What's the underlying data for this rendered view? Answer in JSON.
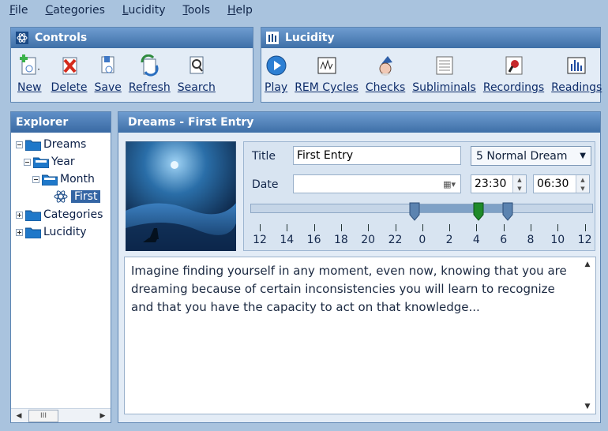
{
  "menu": [
    {
      "label": "File",
      "underline": "F",
      "rest": "ile"
    },
    {
      "label": "Categories",
      "underline": "C",
      "rest": "ategories"
    },
    {
      "label": "Lucidity",
      "underline": "L",
      "rest": "ucidity"
    },
    {
      "label": "Tools",
      "underline": "T",
      "rest": "ools"
    },
    {
      "label": "Help",
      "underline": "H",
      "rest": "elp"
    }
  ],
  "controls": {
    "title": "Controls",
    "buttons": {
      "new": "New",
      "delete": "Delete",
      "save": "Save",
      "refresh": "Refresh",
      "search": "Search"
    }
  },
  "lucidity": {
    "title": "Lucidity",
    "buttons": {
      "play": "Play",
      "rem": "REM Cycles",
      "checks": "Checks",
      "subliminals": "Subliminals",
      "recordings": "Recordings",
      "readings": "Readings"
    }
  },
  "explorer": {
    "title": "Explorer",
    "tree": {
      "dreams": "Dreams",
      "year": "Year",
      "month": "Month",
      "first": "First",
      "categories": "Categories",
      "lucidity": "Lucidity"
    },
    "hscroll_thumb": "III"
  },
  "entry": {
    "panel_title": "Dreams - First Entry",
    "title_label": "Title",
    "title_value": "First Entry",
    "dream_type": "5 Normal Dream",
    "date_label": "Date",
    "date_value": "",
    "sleep_time": "23:30",
    "wake_time": "06:30",
    "timeline_ticks": [
      "12",
      "14",
      "16",
      "18",
      "20",
      "22",
      "0",
      "2",
      "4",
      "6",
      "8",
      "10",
      "12"
    ],
    "body": "Imagine finding yourself in any moment, even now, knowing that you are dreaming because of certain inconsistencies you will learn to recognize and that you have the capacity to act on that knowledge..."
  },
  "colors": {
    "accent": "#3e6fa7",
    "background": "#a9c3de",
    "panel": "#e3ecf6",
    "selection": "#3465a4"
  }
}
